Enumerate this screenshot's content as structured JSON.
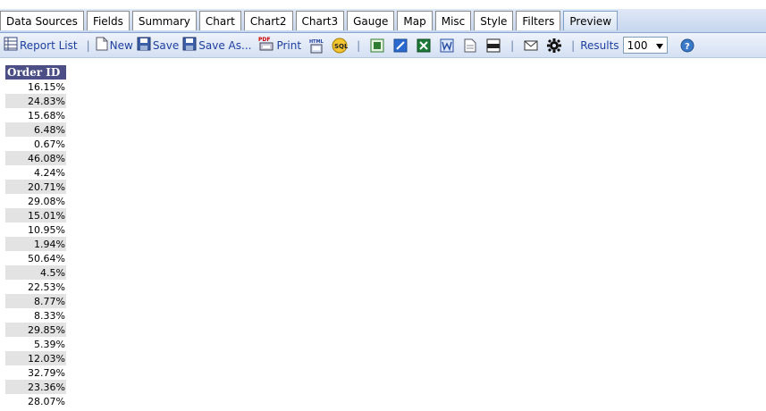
{
  "tabs": [
    {
      "label": "Data Sources",
      "active": false
    },
    {
      "label": "Fields",
      "active": false
    },
    {
      "label": "Summary",
      "active": false
    },
    {
      "label": "Chart",
      "active": false
    },
    {
      "label": "Chart2",
      "active": false
    },
    {
      "label": "Chart3",
      "active": false
    },
    {
      "label": "Gauge",
      "active": false
    },
    {
      "label": "Map",
      "active": false
    },
    {
      "label": "Misc",
      "active": false
    },
    {
      "label": "Style",
      "active": false
    },
    {
      "label": "Filters",
      "active": false
    },
    {
      "label": "Preview",
      "active": true
    }
  ],
  "toolbar": {
    "report_list": "Report List",
    "new": "New",
    "save": "Save",
    "save_as": "Save As...",
    "print": "Print",
    "print_badge": "PDF",
    "html_badge": "HTML",
    "sql_badge": "SQL",
    "results_label": "Results",
    "results_value": "100"
  },
  "table": {
    "header": "Order ID",
    "rows": [
      "16.15%",
      "24.83%",
      "15.68%",
      "6.48%",
      "0.67%",
      "46.08%",
      "4.24%",
      "20.71%",
      "29.08%",
      "15.01%",
      "10.95%",
      "1.94%",
      "50.64%",
      "4.5%",
      "22.53%",
      "8.77%",
      "8.33%",
      "29.85%",
      "5.39%",
      "12.03%",
      "32.79%",
      "23.36%",
      "28.07%"
    ]
  },
  "colors": {
    "header_bg": "#4b4f85",
    "alt_row_bg": "#e3e3e3",
    "toolbar_link": "#1f3fa0"
  }
}
